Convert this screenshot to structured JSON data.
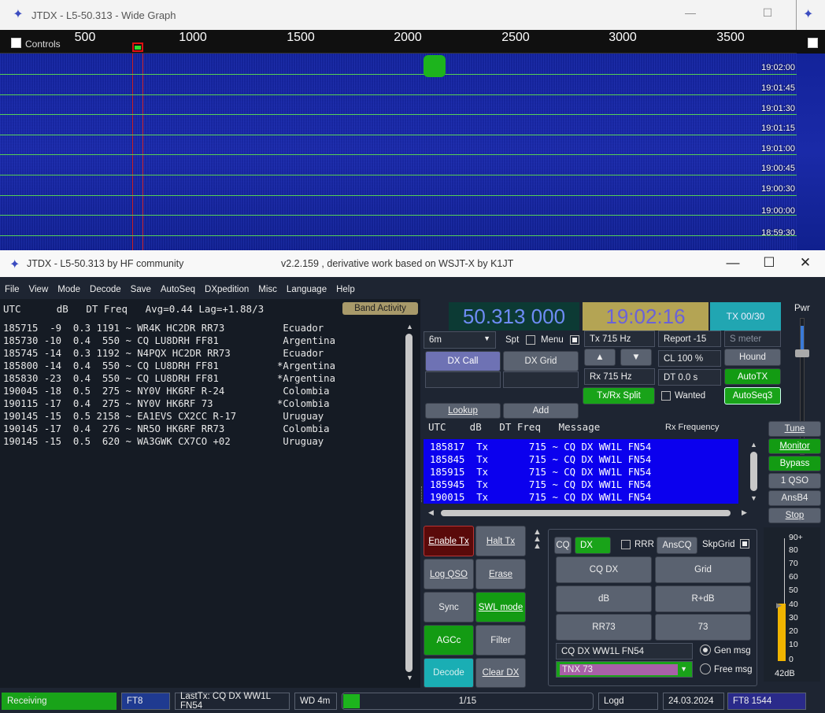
{
  "wide_graph": {
    "title": "JTDX - L5-50.313 - Wide Graph",
    "controls_label": "Controls",
    "freq_ticks": [
      "500",
      "1000",
      "1500",
      "2000",
      "2500",
      "3000",
      "3500"
    ],
    "time_labels": [
      "19:02:00",
      "19:01:45",
      "19:01:30",
      "19:01:15",
      "19:01:00",
      "19:00:45",
      "19:00:30",
      "19:00:00",
      "18:59:30"
    ]
  },
  "main": {
    "title_left": "JTDX - L5-50.313  by HF community",
    "title_right": "v2.2.159 , derivative work based on WSJT-X by K1JT",
    "menu": [
      "File",
      "View",
      "Mode",
      "Decode",
      "Save",
      "AutoSeq",
      "DXpedition",
      "Misc",
      "Language",
      "Help"
    ]
  },
  "band_activity": {
    "header": "UTC      dB   DT Freq   Avg=0.44 Lag=+1.88/3",
    "button": "Band Activity",
    "rows": [
      "185715  -9  0.3 1191 ~ WR4K HC2DR RR73          Ecuador",
      "185730 -10  0.4  550 ~ CQ LU8DRH FF81           Argentina",
      "185745 -14  0.3 1192 ~ N4PQX HC2DR RR73         Ecuador",
      "185800 -14  0.4  550 ~ CQ LU8DRH FF81          *Argentina",
      "185830 -23  0.4  550 ~ CQ LU8DRH FF81          *Argentina",
      "190045 -18  0.5  275 ~ NY0V HK6RF R-24          Colombia",
      "190115 -17  0.4  275 ~ NY0V HK6RF 73           *Colombia",
      "190145 -15  0.5 2158 ~ EA1EVS CX2CC R-17        Uruguay",
      "190145 -17  0.4  276 ~ NR5O HK6RF RR73          Colombia",
      "190145 -15  0.5  620 ~ WA3GWK CX7CO +02         Uruguay"
    ]
  },
  "controls": {
    "frequency": "50.313 000",
    "clock": "19:02:16",
    "tx_count": "TX 00/30",
    "band": "6m",
    "spt": "Spt",
    "menu": "Menu",
    "dx_call": "DX Call",
    "dx_grid": "DX Grid",
    "tx_freq": "Tx  715  Hz",
    "rx_freq": "Rx  715  Hz",
    "report": "Report -15",
    "smeter": "S meter",
    "cl": "CL  100 %",
    "dt": "DT 0.0 s",
    "hound": "Hound",
    "autotx": "AutoTX",
    "txrx_split": "Tx/Rx Split",
    "wanted": "Wanted",
    "autoseq3": "AutoSeq3",
    "lookup": "Lookup",
    "add": "Add",
    "pwr": "Pwr",
    "up_arrow": "▲",
    "down_arrow": "▼"
  },
  "rx_frequency": {
    "header": "UTC    dB   DT Freq   Message",
    "header2": "Rx Frequency",
    "rows": [
      "185817  Tx       715 ~ CQ DX WW1L FN54",
      "185845  Tx       715 ~ CQ DX WW1L FN54",
      "185915  Tx       715 ~ CQ DX WW1L FN54",
      "185945  Tx       715 ~ CQ DX WW1L FN54",
      "190015  Tx       715 ~ CQ DX WW1L FN54"
    ]
  },
  "side_buttons": [
    "Tune",
    "Monitor",
    "Bypass",
    "1 QSO",
    "AnsB4",
    "Stop"
  ],
  "action_buttons": {
    "enable_tx": "Enable Tx",
    "halt_tx": "Halt Tx",
    "log_qso": "Log QSO",
    "erase": "Erase",
    "sync": "Sync",
    "swl_mode": "SWL mode",
    "agcc": "AGCc",
    "filter": "Filter",
    "decode": "Decode",
    "clear_dx": "Clear DX"
  },
  "tx_panel": {
    "cq": "CQ",
    "dx": "DX",
    "rrr": "RRR",
    "anscq": "AnsCQ",
    "skpgrid": "SkpGrid",
    "msg_buttons": [
      "CQ DX",
      "Grid",
      "dB",
      "R+dB",
      "RR73",
      "73"
    ],
    "gen_msg_text": "CQ DX WW1L FN54",
    "free_msg_text": "TNX 73",
    "gen_msg": "Gen msg",
    "free_msg": "Free msg"
  },
  "meter": {
    "scale": [
      "90+",
      "80",
      "70",
      "60",
      "50",
      "40",
      "30",
      "20",
      "10",
      "0"
    ],
    "level_db": 42,
    "label": "42dB"
  },
  "status": {
    "receiving": "Receiving",
    "mode": "FT8",
    "last_tx": "LastTx: CQ DX WW1L FN54",
    "wd": "WD 4m",
    "progress": "1/15",
    "logd": "Logd",
    "date": "24.03.2024",
    "mode_freq": "FT8  1544"
  }
}
